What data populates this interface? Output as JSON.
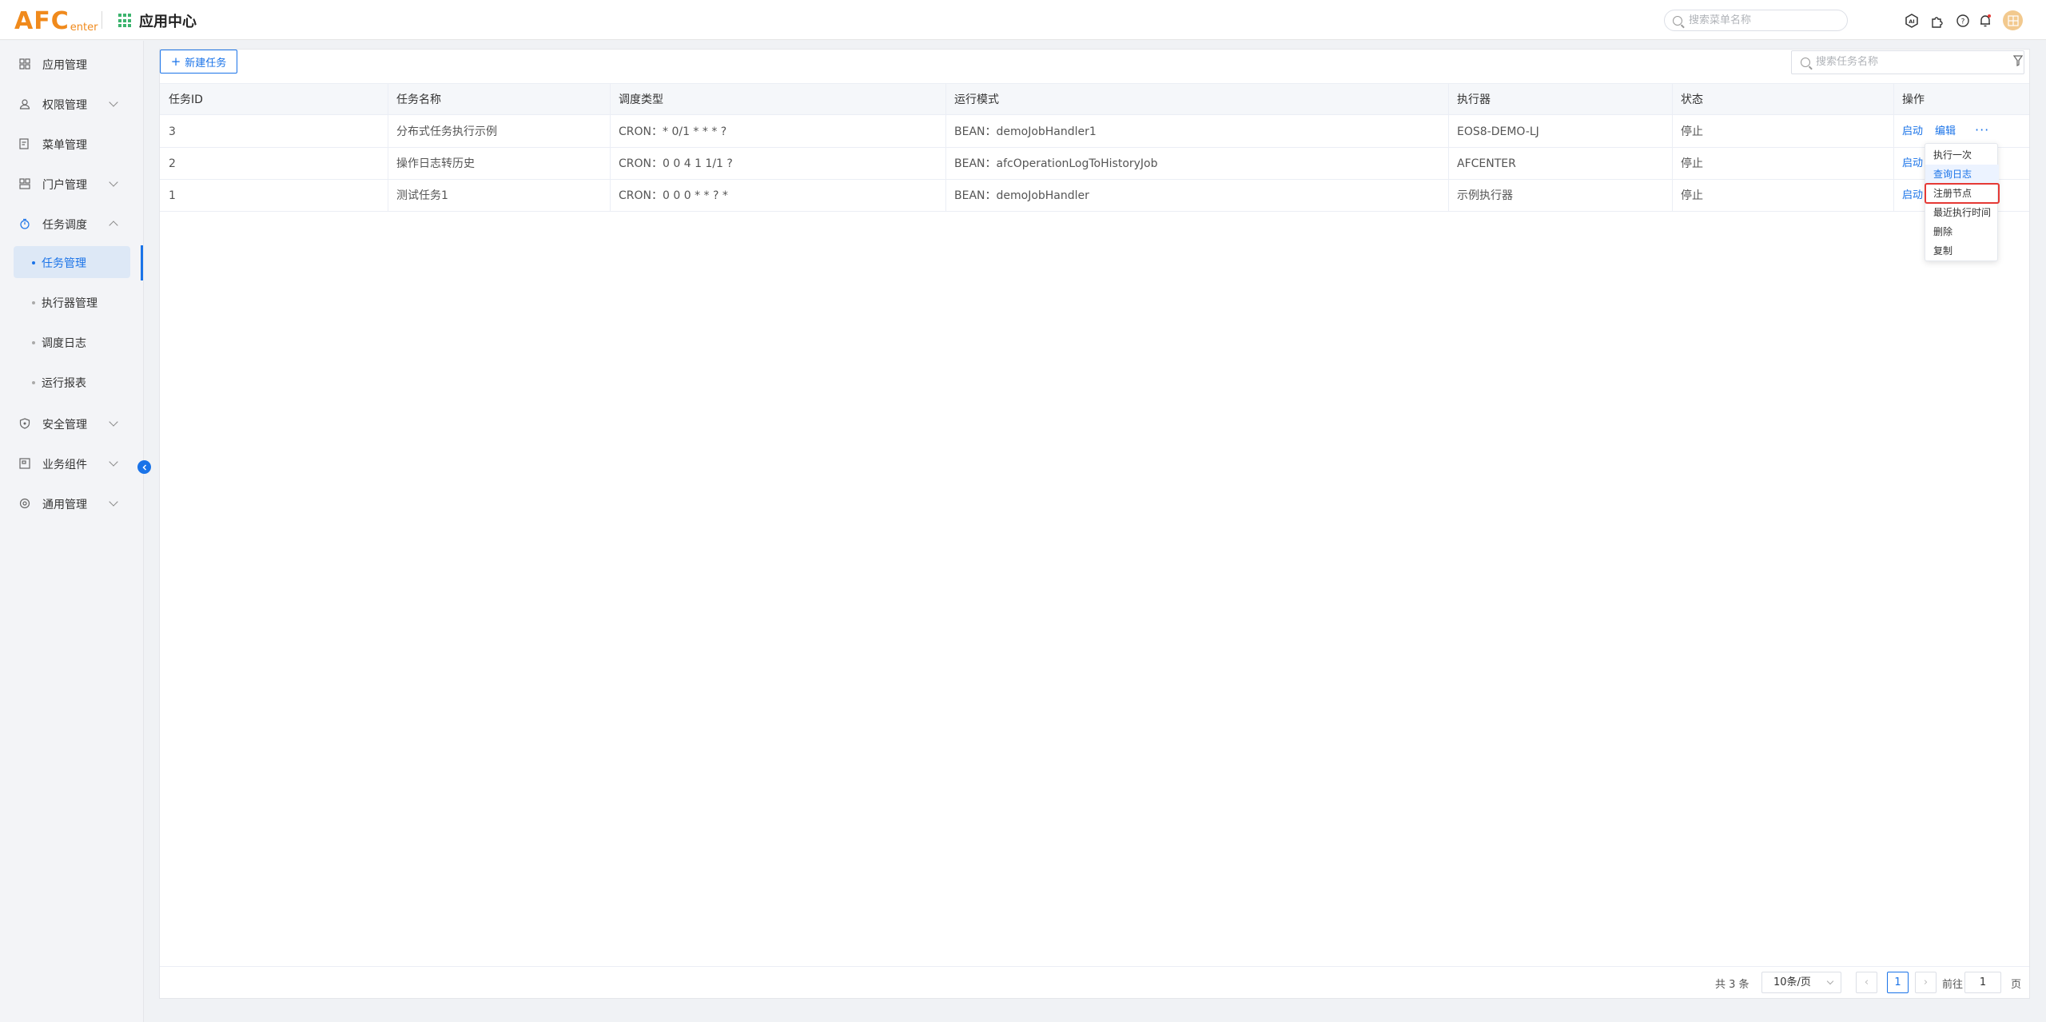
{
  "header": {
    "logo_big": "AFC",
    "logo_small": "enter",
    "app_title": "应用中心",
    "search_placeholder": "搜索菜单名称"
  },
  "sidebar": {
    "items": [
      {
        "label": "应用管理",
        "icon": "apps-icon"
      },
      {
        "label": "权限管理",
        "icon": "user-icon"
      },
      {
        "label": "菜单管理",
        "icon": "menu-doc-icon"
      },
      {
        "label": "门户管理",
        "icon": "portal-icon"
      },
      {
        "label": "任务调度",
        "icon": "schedule-icon"
      },
      {
        "label": "安全管理",
        "icon": "shield-icon"
      },
      {
        "label": "业务组件",
        "icon": "component-icon"
      },
      {
        "label": "通用管理",
        "icon": "settings-icon"
      }
    ],
    "sub_items": [
      {
        "label": "任务管理"
      },
      {
        "label": "执行器管理"
      },
      {
        "label": "调度日志"
      },
      {
        "label": "运行报表"
      }
    ]
  },
  "toolbar": {
    "new_task_label": "新建任务",
    "search_placeholder": "搜索任务名称"
  },
  "table": {
    "headers": [
      "任务ID",
      "任务名称",
      "调度类型",
      "运行模式",
      "执行器",
      "状态",
      "操作"
    ],
    "rows": [
      {
        "id": "3",
        "name": "分布式任务执行示例",
        "schedule": "CRON：* 0/1 * * * ?",
        "mode": "BEAN：demoJobHandler1",
        "executor": "EOS8-DEMO-LJ",
        "status": "停止"
      },
      {
        "id": "2",
        "name": "操作日志转历史",
        "schedule": "CRON：0 0 4 1 1/1 ?",
        "mode": "BEAN：afcOperationLogToHistoryJob",
        "executor": "AFCENTER",
        "status": "停止"
      },
      {
        "id": "1",
        "name": "测试任务1",
        "schedule": "CRON：0 0 0 * * ? *",
        "mode": "BEAN：demoJobHandler",
        "executor": "示例执行器",
        "status": "停止"
      }
    ],
    "op_start": "启动",
    "op_edit": "编辑",
    "op_more": "···"
  },
  "dropdown": {
    "items": [
      "执行一次",
      "查询日志",
      "注册节点",
      "最近执行时间",
      "删除",
      "复制"
    ]
  },
  "pagination": {
    "total": "共 3 条",
    "page_size": "10条/页",
    "prev": "‹",
    "current_page": "1",
    "next": "›",
    "goto_prefix": "前往",
    "goto_value": "1",
    "goto_suffix": "页"
  },
  "colors": {
    "primary": "#1a73e8",
    "logo": "#f08a1c",
    "highlight_border": "#e53935"
  }
}
